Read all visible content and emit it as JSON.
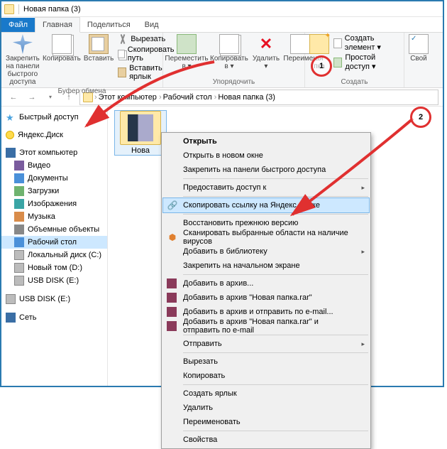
{
  "title": "Новая папка (3)",
  "tabs": {
    "file": "Файл",
    "home": "Главная",
    "share": "Поделиться",
    "view": "Вид"
  },
  "ribbon": {
    "pin": "Закрепить на панели\nбыстрого доступа",
    "copy": "Копировать",
    "paste": "Вставить",
    "cut": "Вырезать",
    "copypath": "Скопировать путь",
    "pastelink": "Вставить ярлык",
    "clipboard_group": "Буфер обмена",
    "moveto": "Переместить\nв ▾",
    "copyto": "Копировать\nв ▾",
    "delete": "Удалить\n▾",
    "rename": "Переимен",
    "organize_group": "Упорядочить",
    "newfolder": "ая\nпка",
    "newitem": "Создать элемент ▾",
    "easyaccess": "Простой доступ ▾",
    "create_group": "Создать",
    "properties": "Свой"
  },
  "breadcrumbs": [
    "Этот компьютер",
    "Рабочий стол",
    "Новая папка (3)"
  ],
  "toolbar_arrows": {
    "up": "↑",
    "back": "←",
    "fwd": "→",
    "down": "▾"
  },
  "sidebar": {
    "quick": "Быстрый доступ",
    "yadisk": "Яндекс.Диск",
    "thispc": "Этот компьютер",
    "items": [
      "Видео",
      "Документы",
      "Загрузки",
      "Изображения",
      "Музыка",
      "Объемные объекты",
      "Рабочий стол",
      "Локальный диск (C:)",
      "Новый том (D:)",
      "USB DISK (E:)",
      "USB DISK (E:)"
    ],
    "network": "Сеть"
  },
  "folder": {
    "name": "Нова"
  },
  "context": [
    {
      "t": "Открыть",
      "bold": true
    },
    {
      "t": "Открыть в новом окне"
    },
    {
      "t": "Закрепить на панели быстрого доступа"
    },
    {
      "sep": true
    },
    {
      "t": "Предоставить доступ к",
      "arrow": true
    },
    {
      "sep": true
    },
    {
      "t": "Скопировать ссылку на Яндекс.Диске",
      "icon": "link",
      "hl": true
    },
    {
      "sep": true
    },
    {
      "t": "Восстановить прежнюю версию"
    },
    {
      "t": "Сканировать выбранные области на наличие вирусов",
      "icon": "shield"
    },
    {
      "t": "Добавить в библиотеку",
      "arrow": true
    },
    {
      "t": "Закрепить на начальном экране"
    },
    {
      "sep": true
    },
    {
      "t": "Добавить в архив...",
      "icon": "rar"
    },
    {
      "t": "Добавить в архив \"Новая папка.rar\"",
      "icon": "rar"
    },
    {
      "t": "Добавить в архив и отправить по e-mail...",
      "icon": "rar"
    },
    {
      "t": "Добавить в архив \"Новая папка.rar\" и отправить по e-mail",
      "icon": "rar"
    },
    {
      "sep": true
    },
    {
      "t": "Отправить",
      "arrow": true
    },
    {
      "sep": true
    },
    {
      "t": "Вырезать"
    },
    {
      "t": "Копировать"
    },
    {
      "sep": true
    },
    {
      "t": "Создать ярлык"
    },
    {
      "t": "Удалить"
    },
    {
      "t": "Переименовать"
    },
    {
      "sep": true
    },
    {
      "t": "Свойства"
    }
  ],
  "annotations": {
    "one": "1",
    "two": "2"
  }
}
